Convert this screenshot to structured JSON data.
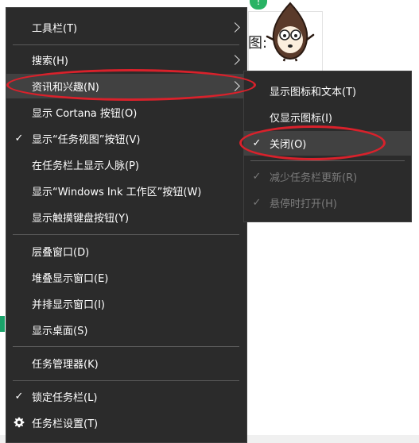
{
  "background": {
    "heading_fragment": "图:",
    "badge_text": "!",
    "accent_color": "#29b364"
  },
  "menu": {
    "items": [
      {
        "label": "工具栏(T)",
        "checked": false,
        "has_submenu": true
      },
      {
        "label": "搜索(H)",
        "checked": false,
        "has_submenu": true
      },
      {
        "label": "资讯和兴趣(N)",
        "checked": false,
        "has_submenu": true,
        "highlighted": true
      },
      {
        "label": "显示 Cortana 按钮(O)",
        "checked": false
      },
      {
        "label": "显示“任务视图”按钮(V)",
        "checked": true
      },
      {
        "label": "在任务栏上显示人脉(P)",
        "checked": false
      },
      {
        "label": "显示“Windows Ink 工作区”按钮(W)",
        "checked": false
      },
      {
        "label": "显示触摸键盘按钮(Y)",
        "checked": false
      },
      {
        "label": "层叠窗口(D)",
        "checked": false
      },
      {
        "label": "堆叠显示窗口(E)",
        "checked": false
      },
      {
        "label": "并排显示窗口(I)",
        "checked": false
      },
      {
        "label": "显示桌面(S)",
        "checked": false
      },
      {
        "label": "任务管理器(K)",
        "checked": false
      },
      {
        "label": "锁定任务栏(L)",
        "checked": true
      },
      {
        "label": "任务栏设置(T)",
        "checked": false,
        "icon": "gear-icon"
      }
    ],
    "check_glyph": "✓"
  },
  "submenu": {
    "items": [
      {
        "label": "显示图标和文本(T)",
        "checked": false
      },
      {
        "label": "仅显示图标(I)",
        "checked": false
      },
      {
        "label": "关闭(O)",
        "checked": true,
        "highlighted": true
      },
      {
        "label": "减少任务栏更新(R)",
        "checked": true,
        "disabled": true
      },
      {
        "label": "悬停时打开(H)",
        "checked": true,
        "disabled": true
      }
    ]
  },
  "annotation_color": "#d9212b"
}
